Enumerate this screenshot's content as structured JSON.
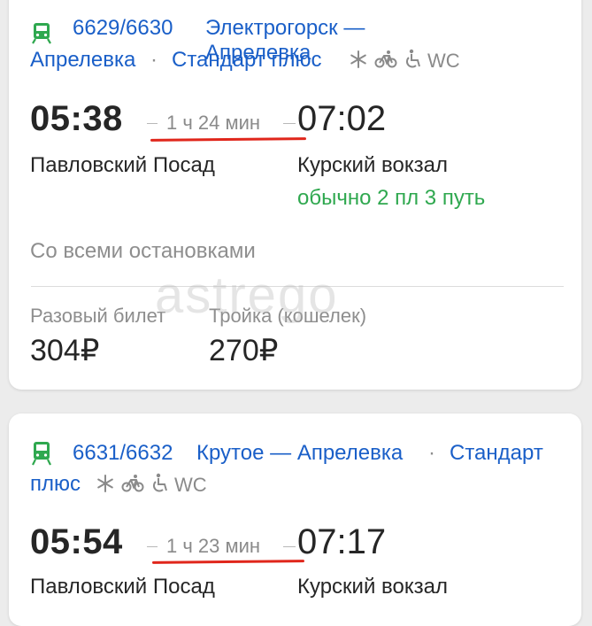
{
  "colors": {
    "link": "#1a5fc8",
    "success": "#2fa84f",
    "underline": "#e0261b"
  },
  "watermark": "astrego",
  "trains": [
    {
      "icon": "train-icon",
      "number": "6629/6630",
      "route": "Электрогорск — Апрелевка",
      "separator": "·",
      "category": "Стандарт плюс",
      "amenities": [
        "snowflake-icon",
        "bicycle-icon",
        "wheelchair-icon"
      ],
      "wc": "WC",
      "departure_time": "05:38",
      "duration": "1 ч 24 мин",
      "arrival_time": "07:02",
      "from": "Павловский Посад",
      "to": "Курский вокзал",
      "platform": "обычно 2 пл 3 путь",
      "stops": "Со всеми остановками",
      "fares": [
        {
          "label": "Разовый билет",
          "price": "304₽"
        },
        {
          "label": "Тройка (кошелек)",
          "price": "270₽"
        }
      ]
    },
    {
      "icon": "train-icon",
      "number": "6631/6632",
      "route": "Крутое — Апрелевка",
      "separator": "·",
      "category": "Стандарт плюс",
      "amenities": [
        "snowflake-icon",
        "bicycle-icon",
        "wheelchair-icon"
      ],
      "wc": "WC",
      "departure_time": "05:54",
      "duration": "1 ч 23 мин",
      "arrival_time": "07:17",
      "from": "Павловский Посад",
      "to": "Курский вокзал"
    }
  ]
}
